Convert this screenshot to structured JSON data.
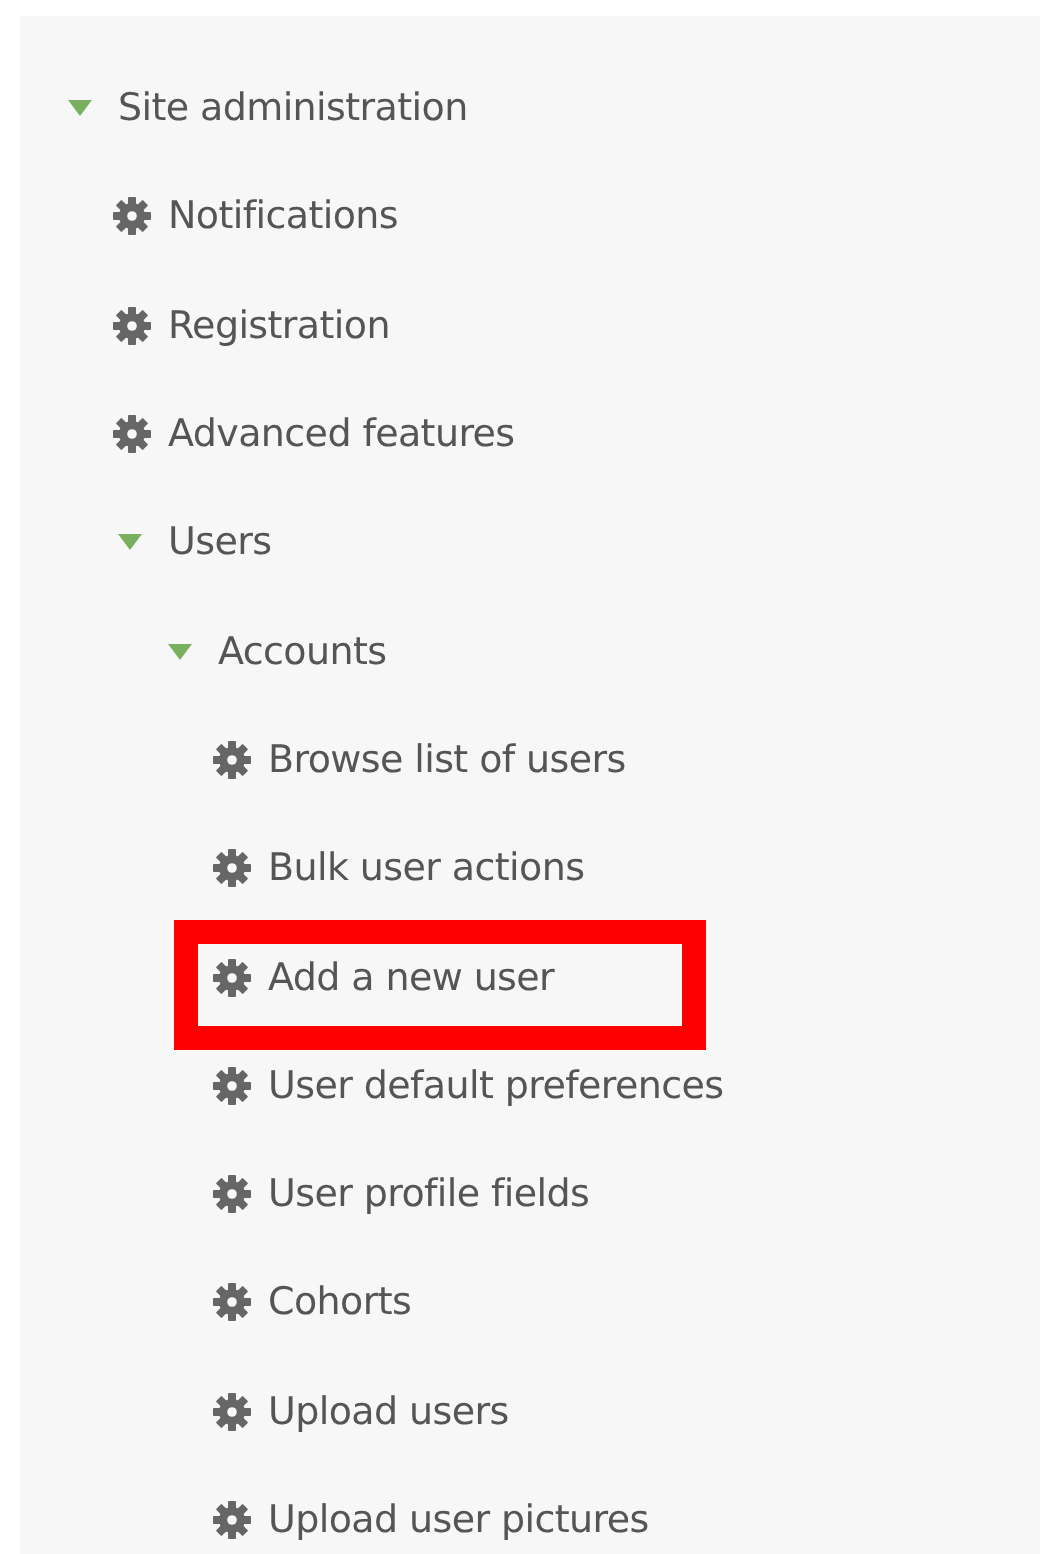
{
  "tree": [
    {
      "label": "Site administration",
      "kind": "branch",
      "expanded": true,
      "highlighted": false,
      "children": [
        {
          "label": "Notifications",
          "kind": "setting",
          "highlighted": false
        },
        {
          "label": "Registration",
          "kind": "setting",
          "highlighted": false
        },
        {
          "label": "Advanced features",
          "kind": "setting",
          "highlighted": false
        },
        {
          "label": "Users",
          "kind": "branch",
          "expanded": true,
          "highlighted": false,
          "children": [
            {
              "label": "Accounts",
              "kind": "branch",
              "expanded": true,
              "highlighted": false,
              "children": [
                {
                  "label": "Browse list of users",
                  "kind": "setting",
                  "highlighted": false
                },
                {
                  "label": "Bulk user actions",
                  "kind": "setting",
                  "highlighted": false
                },
                {
                  "label": "Add a new user",
                  "kind": "setting",
                  "highlighted": true
                },
                {
                  "label": "User default preferences",
                  "kind": "setting",
                  "highlighted": false
                },
                {
                  "label": "User profile fields",
                  "kind": "setting",
                  "highlighted": false
                },
                {
                  "label": "Cohorts",
                  "kind": "setting",
                  "highlighted": false
                },
                {
                  "label": "Upload users",
                  "kind": "setting",
                  "highlighted": false
                },
                {
                  "label": "Upload user pictures",
                  "kind": "setting",
                  "highlighted": false
                }
              ]
            }
          ]
        }
      ]
    }
  ]
}
